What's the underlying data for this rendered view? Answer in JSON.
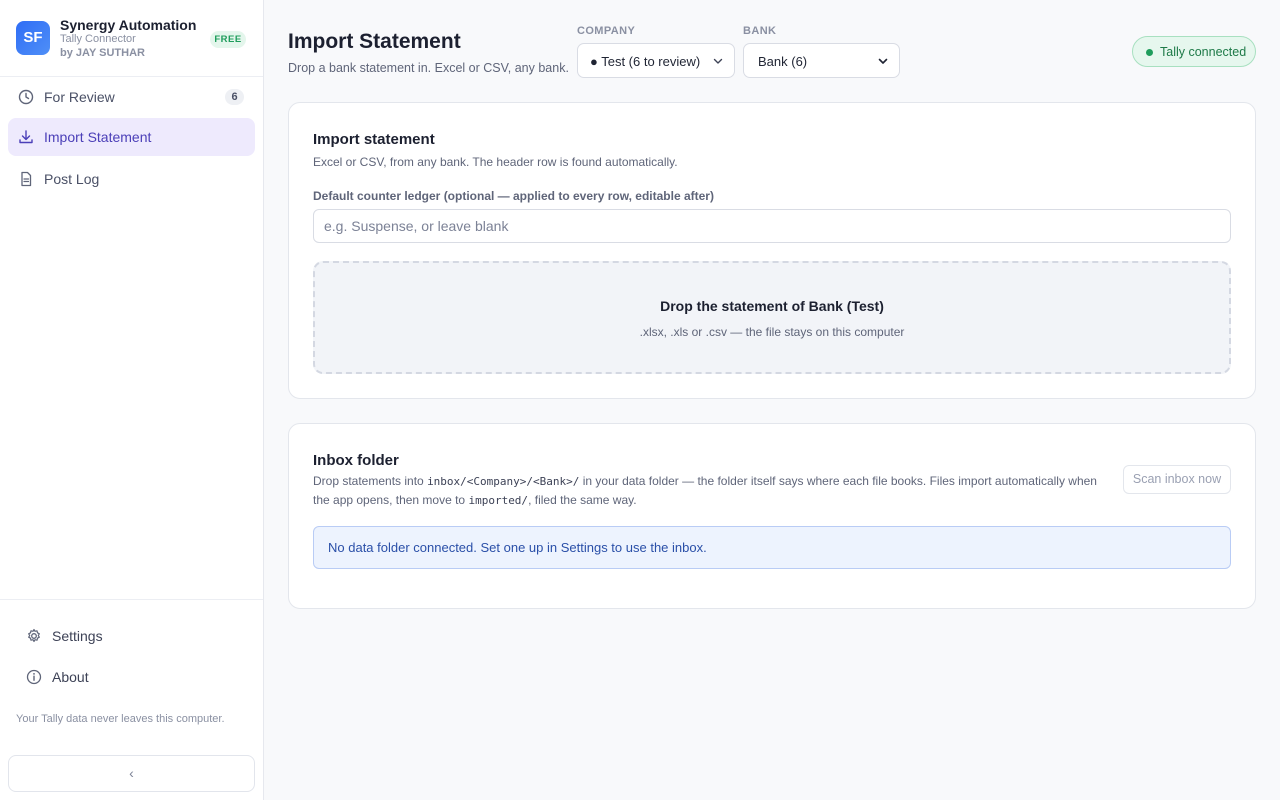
{
  "brand": {
    "logo_text": "SF",
    "name": "Synergy Automation",
    "subtitle": "Tally Connector",
    "byline": "by JAY SUTHAR",
    "plan_badge": "FREE"
  },
  "sidebar": {
    "items": [
      {
        "label": "For Review",
        "icon": "clock-icon",
        "badge": "6",
        "active": false
      },
      {
        "label": "Import Statement",
        "icon": "download-icon",
        "active": true
      },
      {
        "label": "Post Log",
        "icon": "document-icon",
        "active": false
      }
    ],
    "bottom_items": [
      {
        "label": "Settings",
        "icon": "gear-icon"
      },
      {
        "label": "About",
        "icon": "info-icon"
      }
    ],
    "footer_note": "Your Tally data never leaves this computer.",
    "collapse_label": "‹"
  },
  "header": {
    "title": "Import Statement",
    "subtitle": "Drop a bank statement in. Excel or CSV, any bank.",
    "company_label": "COMPANY",
    "company_value": "● Test (6 to review)",
    "bank_label": "BANK",
    "bank_value": "Bank (6)",
    "status": "Tally connected"
  },
  "import_card": {
    "title": "Import statement",
    "description": "Excel or CSV, from any bank. The header row is found automatically.",
    "ledger_label": "Default counter ledger (optional — applied to every row, editable after)",
    "ledger_placeholder": "e.g. Suspense, or leave blank",
    "ledger_value": "",
    "drop_title": "Drop the statement of Bank (Test)",
    "drop_subtitle": ".xlsx, .xls or .csv — the file stays on this computer"
  },
  "inbox_card": {
    "title": "Inbox folder",
    "desc_part1": "Drop statements into ",
    "desc_code1": "inbox/<Company>/<Bank>/",
    "desc_part2": " in your data folder — the folder itself says where each file books. Files import automatically when the app opens, then move to ",
    "desc_code2": "imported/",
    "desc_part3": ", filed the same way.",
    "scan_button": "Scan inbox now",
    "info_message": "No data folder connected. Set one up in Settings to use the inbox."
  },
  "colors": {
    "accent": "#4b3fb8",
    "active_bg": "#eeeafd",
    "success": "#1f9d5c",
    "info": "#2a4fa8"
  }
}
